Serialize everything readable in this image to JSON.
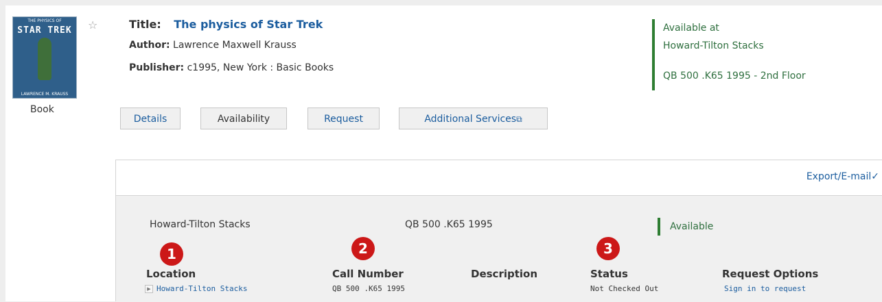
{
  "record": {
    "format_label": "Book",
    "cover": {
      "top_text": "THE PHYSICS OF",
      "title_text": "STAR TREK",
      "author_text": "LAWRENCE M. KRAUSS"
    },
    "title_label": "Title:",
    "title": "The physics of Star Trek",
    "author_label": "Author:",
    "author": "Lawrence Maxwell Krauss",
    "publisher_label": "Publisher:",
    "publisher": "c1995, New York : Basic Books",
    "favorite_icon": "star-icon"
  },
  "availability_summary": {
    "line1": "Available at",
    "line2": "Howard-Tilton Stacks",
    "call_line": "QB 500 .K65 1995 - 2nd Floor",
    "accent": "#2e7d32"
  },
  "tabs": [
    {
      "label": "Details"
    },
    {
      "label": "Availability"
    },
    {
      "label": "Request"
    },
    {
      "label": "Additional Services",
      "icon": "external-link-icon"
    }
  ],
  "holdings_panel": {
    "export_label": "Export/E-mail",
    "summary": {
      "location": "Howard-Tilton Stacks",
      "call_number": "QB 500 .K65 1995",
      "status": "Available"
    },
    "markers": [
      "1",
      "2",
      "3"
    ],
    "columns": [
      "Location",
      "Call Number",
      "Description",
      "Status",
      "Request Options"
    ],
    "rows": [
      {
        "location": "Howard-Tilton Stacks",
        "call_number": "QB 500 .K65 1995",
        "description": "",
        "status": "Not Checked Out",
        "request_option": "Sign in to request"
      }
    ]
  },
  "colors": {
    "link": "#1a5c9e",
    "marker": "#cc1818",
    "page_bg": "#eeeeee"
  }
}
